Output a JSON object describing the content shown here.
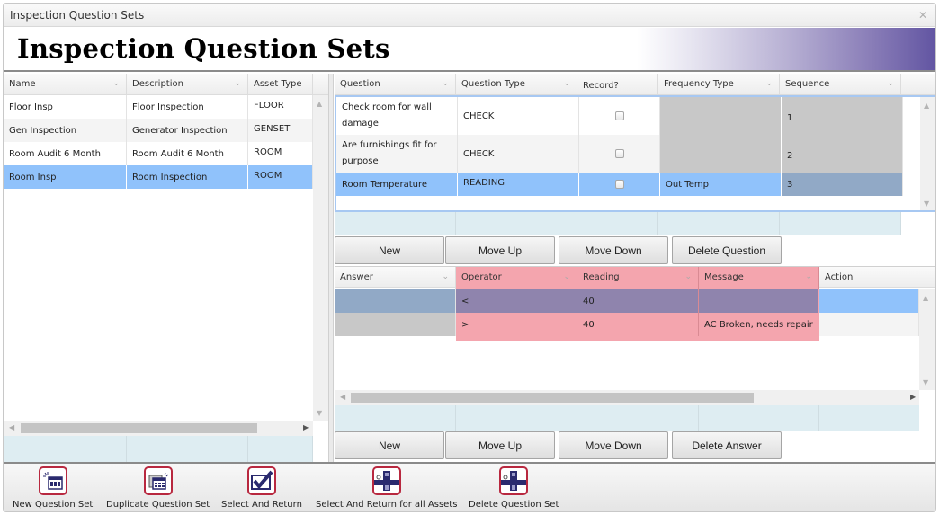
{
  "window": {
    "title": "Inspection Question Sets",
    "close_icon": "close-icon"
  },
  "banner": {
    "heading": "Inspection Question Sets"
  },
  "sets_grid": {
    "columns": [
      "Name",
      "Description",
      "Asset Type"
    ],
    "rows": [
      {
        "name": "Floor Insp",
        "description": "Floor Inspection",
        "asset_type": "FLOOR"
      },
      {
        "name": "Gen Inspection",
        "description": "Generator Inspection",
        "asset_type": "GENSET"
      },
      {
        "name": "Room Audit 6 Month",
        "description": "Room Audit 6 Month",
        "asset_type": "ROOM"
      },
      {
        "name": "Room Insp",
        "description": "Room Inspection",
        "asset_type": "ROOM",
        "selected": true
      }
    ]
  },
  "questions_grid": {
    "columns": [
      "Question",
      "Question Type",
      "Record?",
      "Frequency Type",
      "Sequence"
    ],
    "rows": [
      {
        "question": "Check room for wall damage",
        "type": "CHECK",
        "record": false,
        "frequency": "",
        "sequence": "1"
      },
      {
        "question": "Are furnishings fit for purpose",
        "type": "CHECK",
        "record": false,
        "frequency": "",
        "sequence": "2"
      },
      {
        "question": "Room Temperature",
        "type": "READING",
        "record": false,
        "frequency": "Out Temp",
        "sequence": "3",
        "selected": true
      }
    ],
    "buttons": {
      "new": "New",
      "move_up": "Move Up",
      "move_down": "Move Down",
      "delete": "Delete Question"
    }
  },
  "answers_grid": {
    "columns": [
      "Answer",
      "Operator",
      "Reading",
      "Message",
      "Action"
    ],
    "rows": [
      {
        "answer": "",
        "operator": "<",
        "reading": "40",
        "message": "",
        "action": "",
        "selected": true
      },
      {
        "answer": "",
        "operator": ">",
        "reading": "40",
        "message": "AC Broken, needs repair",
        "action": ""
      }
    ],
    "buttons": {
      "new": "New",
      "move_up": "Move Up",
      "move_down": "Move Down",
      "delete": "Delete Answer"
    }
  },
  "colors": {
    "selected_row": "#90c2fb",
    "readonly_cell": "#c8c8c8",
    "readonly_selected": "#91a9c6",
    "highlight_pink": "#f4a5ae",
    "highlight_selected": "#8f84ad",
    "footer_row": "#deedf2",
    "icon_border": "#b8283f",
    "icon_fill": "#2a2a6e"
  },
  "toolbar": {
    "items": [
      {
        "label": "New Question Set",
        "icon": "new-grid-icon"
      },
      {
        "label": "Duplicate Question Set",
        "icon": "duplicate-grid-icon"
      },
      {
        "label": "Select And Return",
        "icon": "checkmark-icon"
      },
      {
        "label": "Select And Return for all Assets",
        "icon": "pipe-fitting-icon"
      },
      {
        "label": "Delete Question Set",
        "icon": "pipe-fitting-icon"
      }
    ]
  }
}
